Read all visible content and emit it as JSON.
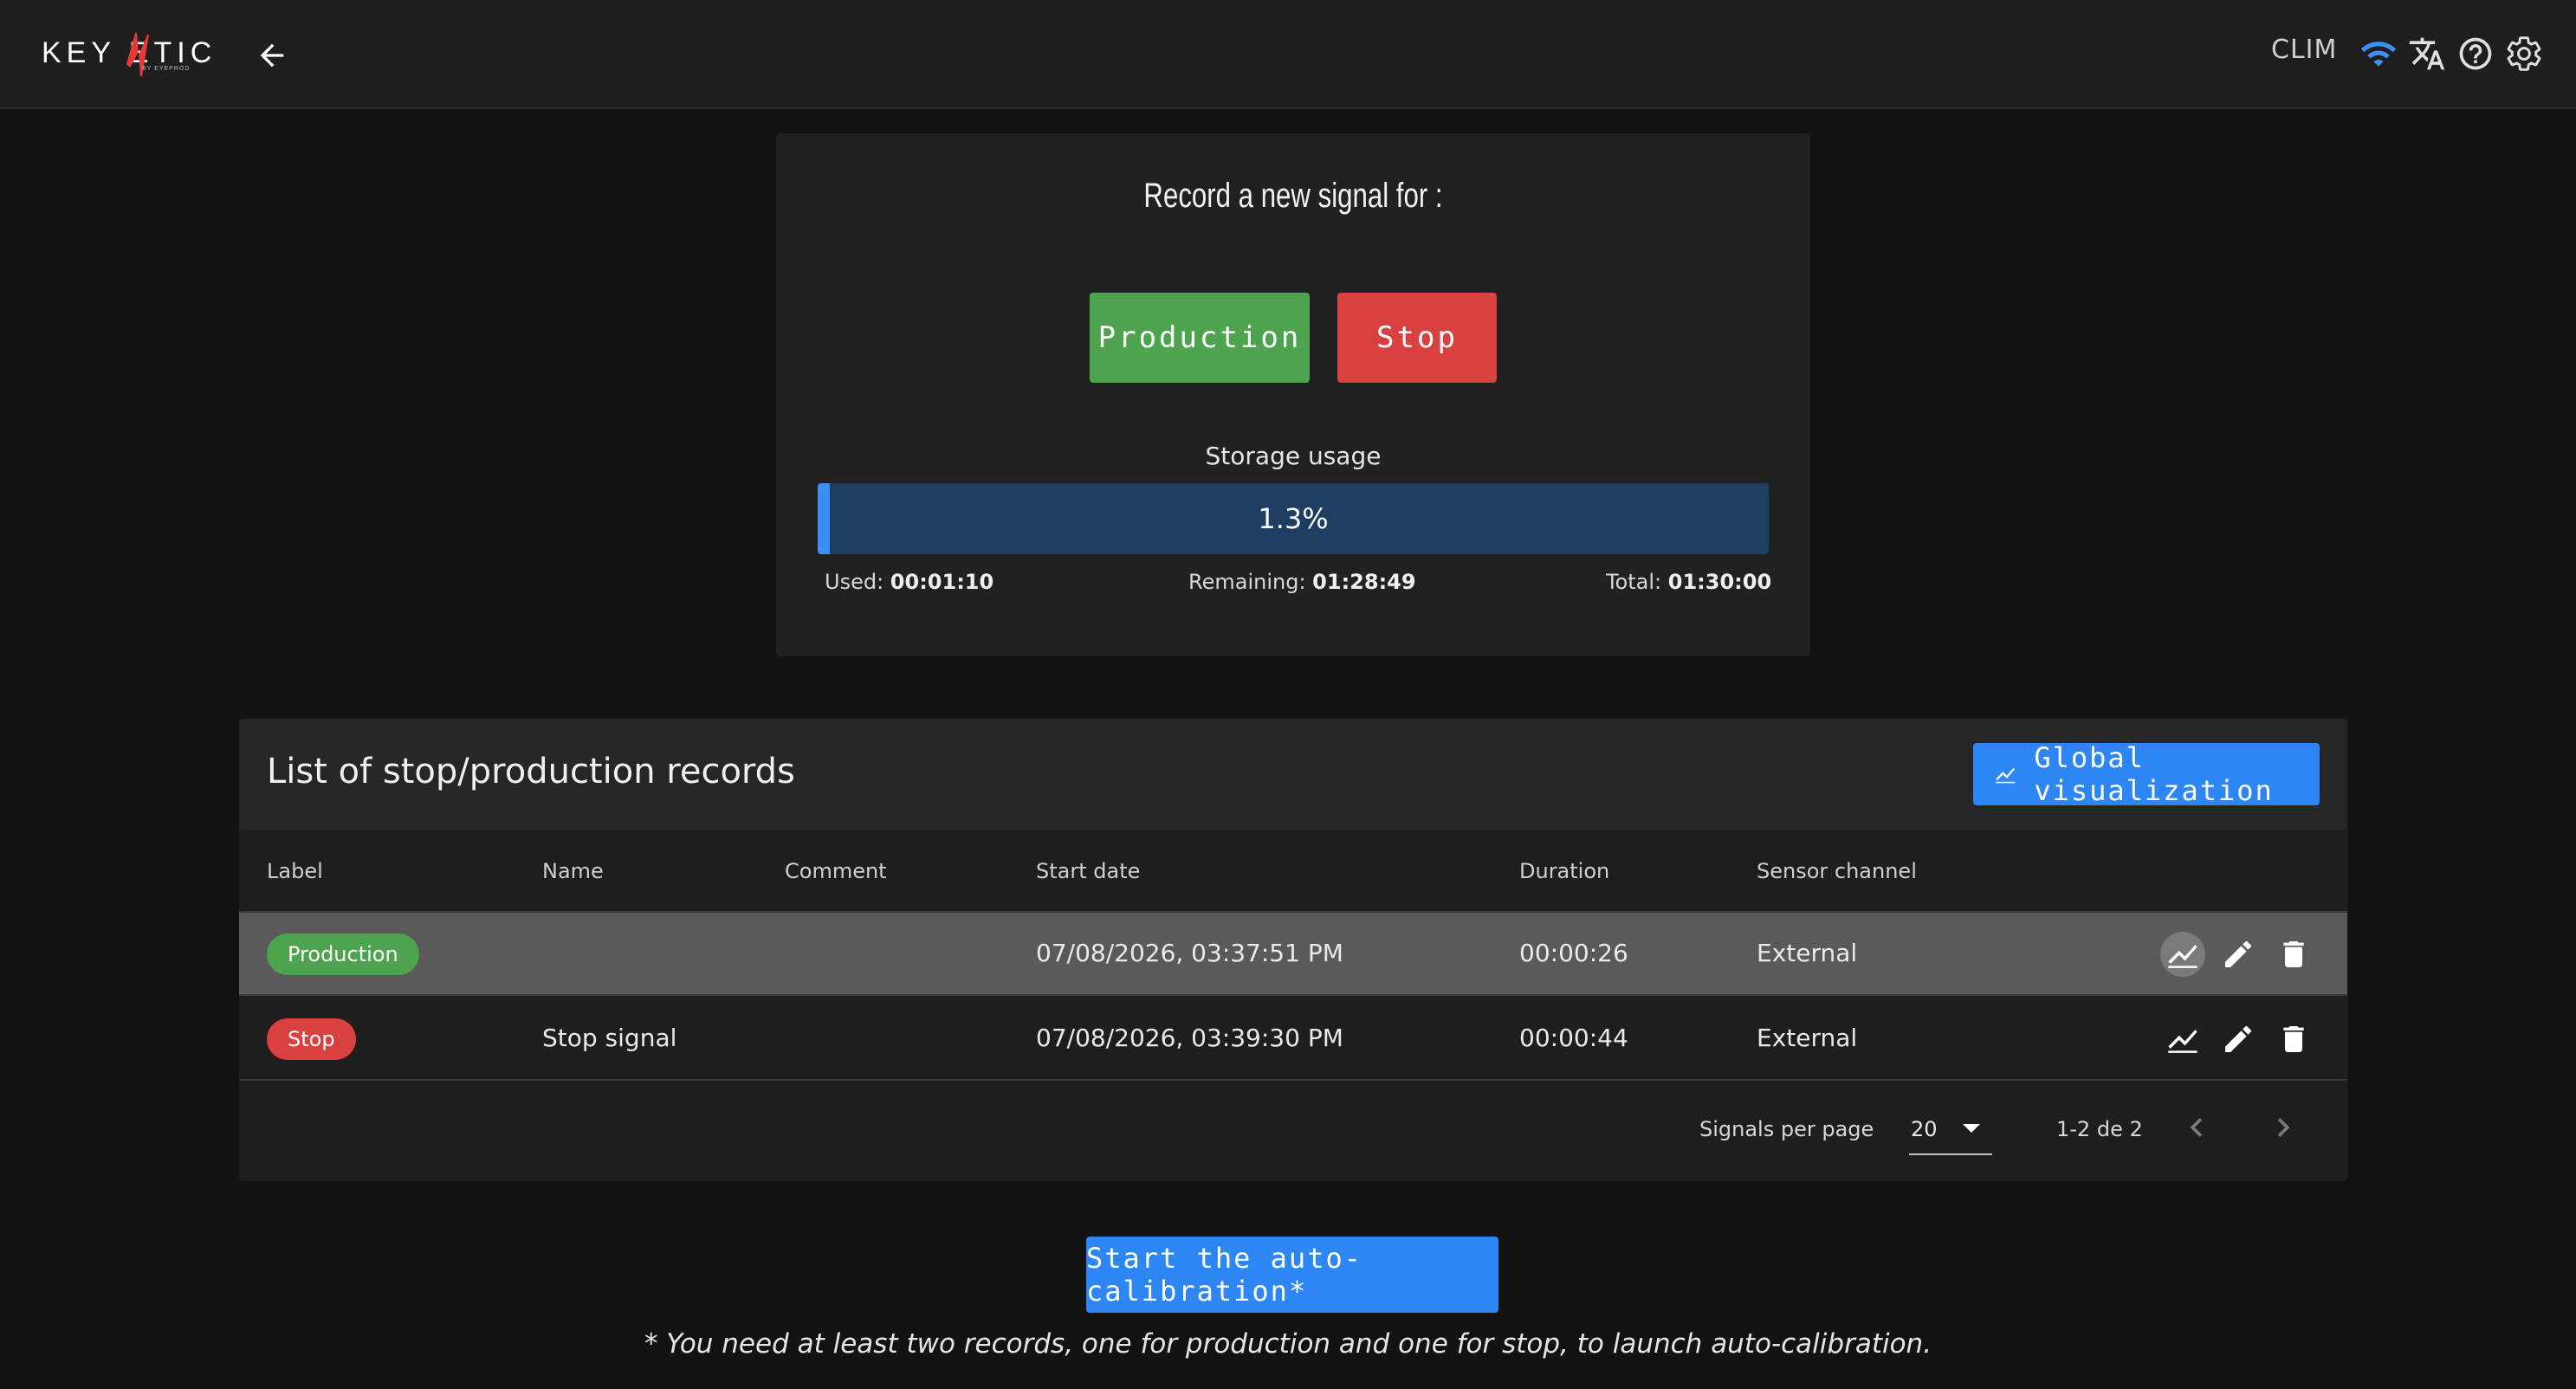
{
  "header": {
    "logo_text": "KEY ETIC",
    "logo_subtext": "BY EYEPROD",
    "device_name": "CLIM",
    "icons": [
      "wifi-icon",
      "translate-icon",
      "help-icon",
      "settings-icon"
    ],
    "wifi_color": "#3d8ff5"
  },
  "record": {
    "title": "Record a new signal for :",
    "production_label": "Production",
    "stop_label": "Stop",
    "production_color": "#4ea34e",
    "stop_color": "#d94040"
  },
  "storage": {
    "label": "Storage usage",
    "percent": 1.3,
    "percent_text": "1.3%",
    "used_label": "Used:",
    "used_value": "00:01:10",
    "remaining_label": "Remaining:",
    "remaining_value": "01:28:49",
    "total_label": "Total:",
    "total_value": "01:30:00"
  },
  "records": {
    "title": "List of stop/production records",
    "global_button": "Global visualization",
    "columns": [
      "Label",
      "Name",
      "Comment",
      "Start date",
      "Duration",
      "Sensor channel"
    ],
    "rows": [
      {
        "label": "Production",
        "label_color": "#4ea34e",
        "name": "",
        "comment": "",
        "start_date": "07/08/2026, 03:37:51 PM",
        "duration": "00:00:26",
        "channel": "External"
      },
      {
        "label": "Stop",
        "label_color": "#d94040",
        "name": "Stop signal",
        "comment": "",
        "start_date": "07/08/2026, 03:39:30 PM",
        "duration": "00:00:44",
        "channel": "External"
      }
    ],
    "pagination": {
      "per_page_label": "Signals per page",
      "per_page_value": "20",
      "range": "1-2 de 2"
    }
  },
  "calibration": {
    "button": "Start the auto-calibration*",
    "footnote": "* You need at least two records, one for production and one for stop, to launch auto-calibration."
  }
}
